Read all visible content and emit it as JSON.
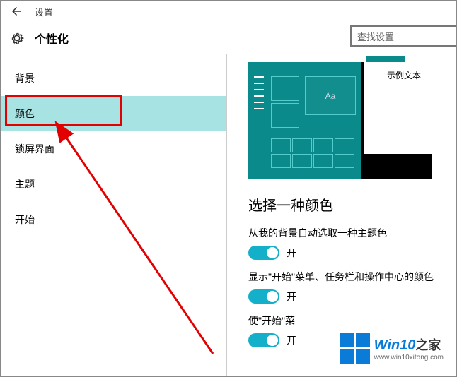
{
  "titlebar": {
    "label": "设置"
  },
  "header": {
    "title": "个性化"
  },
  "search": {
    "placeholder": "查找设置"
  },
  "sidebar": {
    "items": [
      {
        "label": "背景"
      },
      {
        "label": "颜色"
      },
      {
        "label": "锁屏界面"
      },
      {
        "label": "主题"
      },
      {
        "label": "开始"
      }
    ]
  },
  "preview": {
    "sample_text": "示例文本",
    "tile_text": "Aa"
  },
  "content": {
    "section_title": "选择一种颜色",
    "auto_color": {
      "label": "从我的背景自动选取一种主题色",
      "state": "开"
    },
    "start_color": {
      "label": "显示\"开始\"菜单、任务栏和操作中心的颜色",
      "state": "开"
    },
    "transparent": {
      "label": "使\"开始\"菜",
      "state": "开"
    }
  },
  "watermark": {
    "brand": "Win10",
    "suffix": "之家",
    "url": "www.win10xitong.com"
  }
}
